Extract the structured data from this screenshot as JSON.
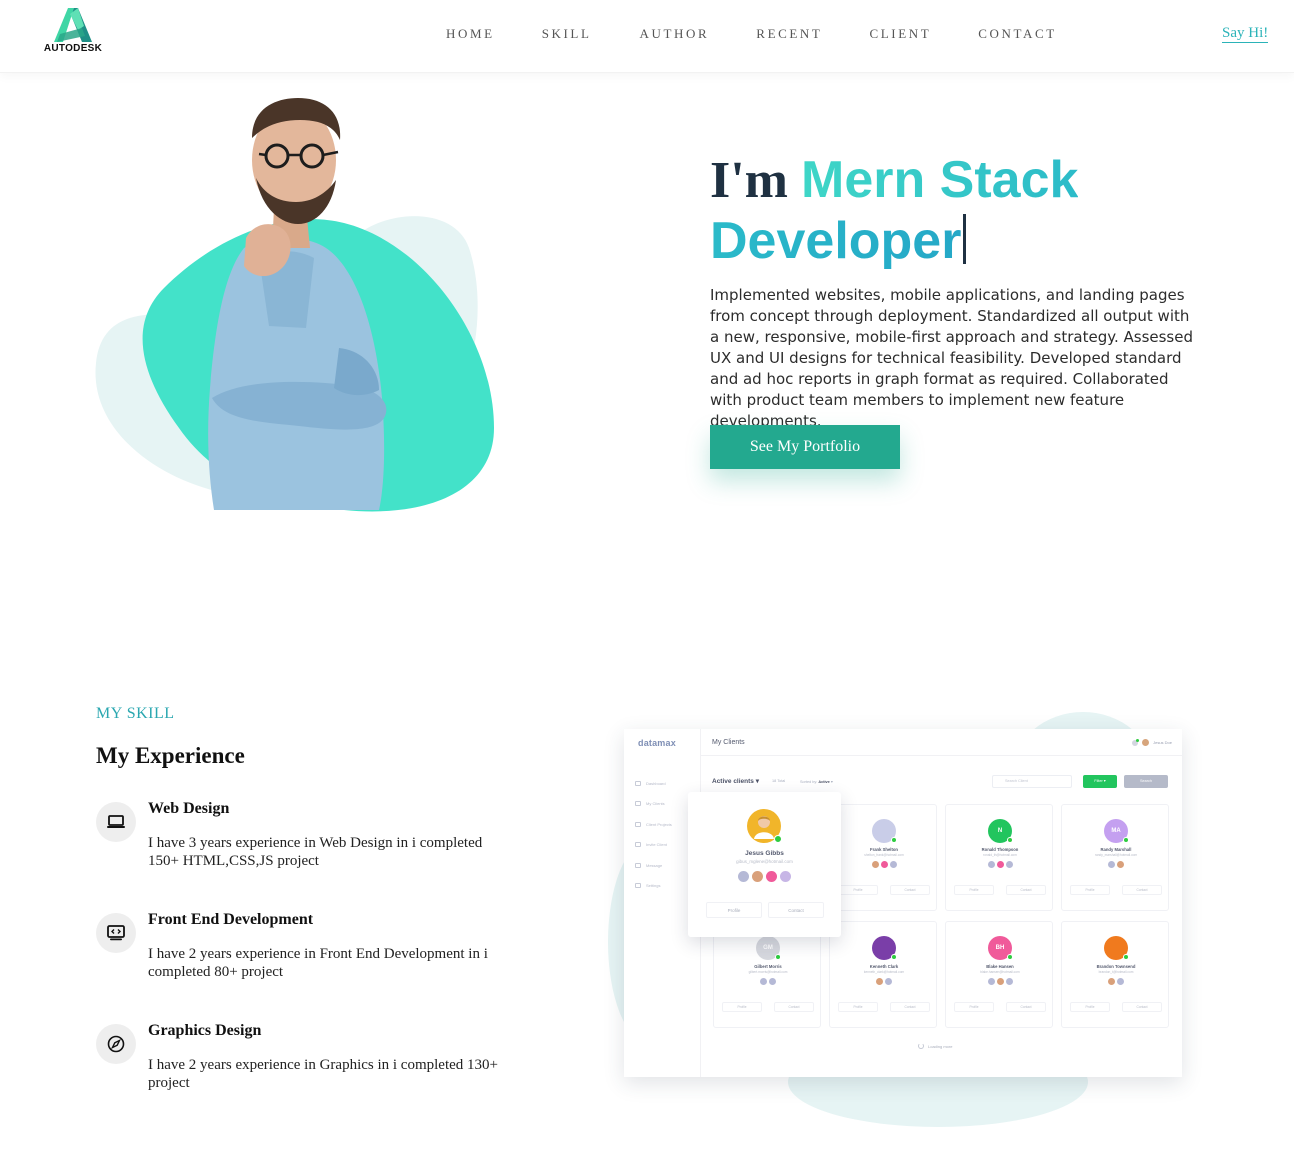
{
  "brand": {
    "name": "AUTODESK",
    "colors": {
      "logo_green": "#3fd6a5",
      "logo_teal": "#1f8f86"
    }
  },
  "nav": {
    "items": [
      "HOME",
      "SKILL",
      "AUTHOR",
      "RECENT",
      "CLIENT",
      "CONTACT"
    ],
    "cta": "Say Hi!"
  },
  "hero": {
    "im": "I'm",
    "role": "Mern Stack Developer",
    "description": "Implemented websites, mobile applications, and landing pages from concept through deployment. Standardized all output with a new, responsive, mobile-first approach and strategy. Assessed UX and UI designs for technical feasibility. Developed standard and ad hoc reports in graph format as required. Collaborated with product team members to implement new feature developments.",
    "button": "See My Portfolio",
    "colors": {
      "accent": "#23a98f",
      "blob": "#43e2c9",
      "blob_light": "#e6f4f4",
      "heading": "#1f3142"
    }
  },
  "skills": {
    "kicker": "MY SKILL",
    "heading": "My Experience",
    "items": [
      {
        "icon": "laptop-icon",
        "title": "Web Design",
        "text": "I have 3 years experience in Web Design in i completed 150+ HTML,CSS,JS project"
      },
      {
        "icon": "code-monitor-icon",
        "title": "Front End Development",
        "text": "I have 2 years experience in Front End Development in i completed 80+ project"
      },
      {
        "icon": "compass-icon",
        "title": "Graphics Design",
        "text": "I have 2 years experience in Graphics in i completed 130+ project"
      }
    ]
  },
  "dashboard": {
    "logo": "datamax",
    "page_title": "My Clients",
    "user": "Jesus Doe",
    "sidebar": [
      "Dashboard",
      "My Clients",
      "Client Projects",
      "Invite Client",
      "Message",
      "Settings"
    ],
    "active_clients": "Active clients",
    "total": "18 Total",
    "sorted_label": "Sorted by:",
    "sorted_value": "Active",
    "search_placeholder": "Search Client",
    "filter": "Filter",
    "search_button": "Search",
    "profile": "Profile",
    "contact": "Contact",
    "loading": "Loading more",
    "featured": {
      "name": "Jesus Gibbs",
      "email": "gibus_mglene@hotmail.com"
    },
    "clients": [
      {
        "name": "Frank Shelton",
        "email": "shelton_frank@hotmail.com",
        "initials": "",
        "color": "#c9cde8"
      },
      {
        "name": "Ronald Thompson",
        "email": "ronald_th@hotmail.com",
        "initials": "N",
        "color": "#22c55e"
      },
      {
        "name": "Randy Marshall",
        "email": "randy_marshall@hotmail.com",
        "initials": "MA",
        "color": "#c4a0f0"
      },
      {
        "name": "Gilbert Morris",
        "email": "gilbert.morris@hotmail.com",
        "initials": "GM",
        "color": "#d6d8de"
      },
      {
        "name": "Kenneth Clark",
        "email": "kenneth_clark@hotmail.com",
        "initials": "",
        "color": "#7a3ea8"
      },
      {
        "name": "Blake Hansen",
        "email": "blake.hansen@hotmail.com",
        "initials": "BH",
        "color": "#f05a9a"
      },
      {
        "name": "Brandon Townsend",
        "email": "brandon_t@hotmail.com",
        "initials": "",
        "color": "#f07a1e"
      }
    ]
  }
}
